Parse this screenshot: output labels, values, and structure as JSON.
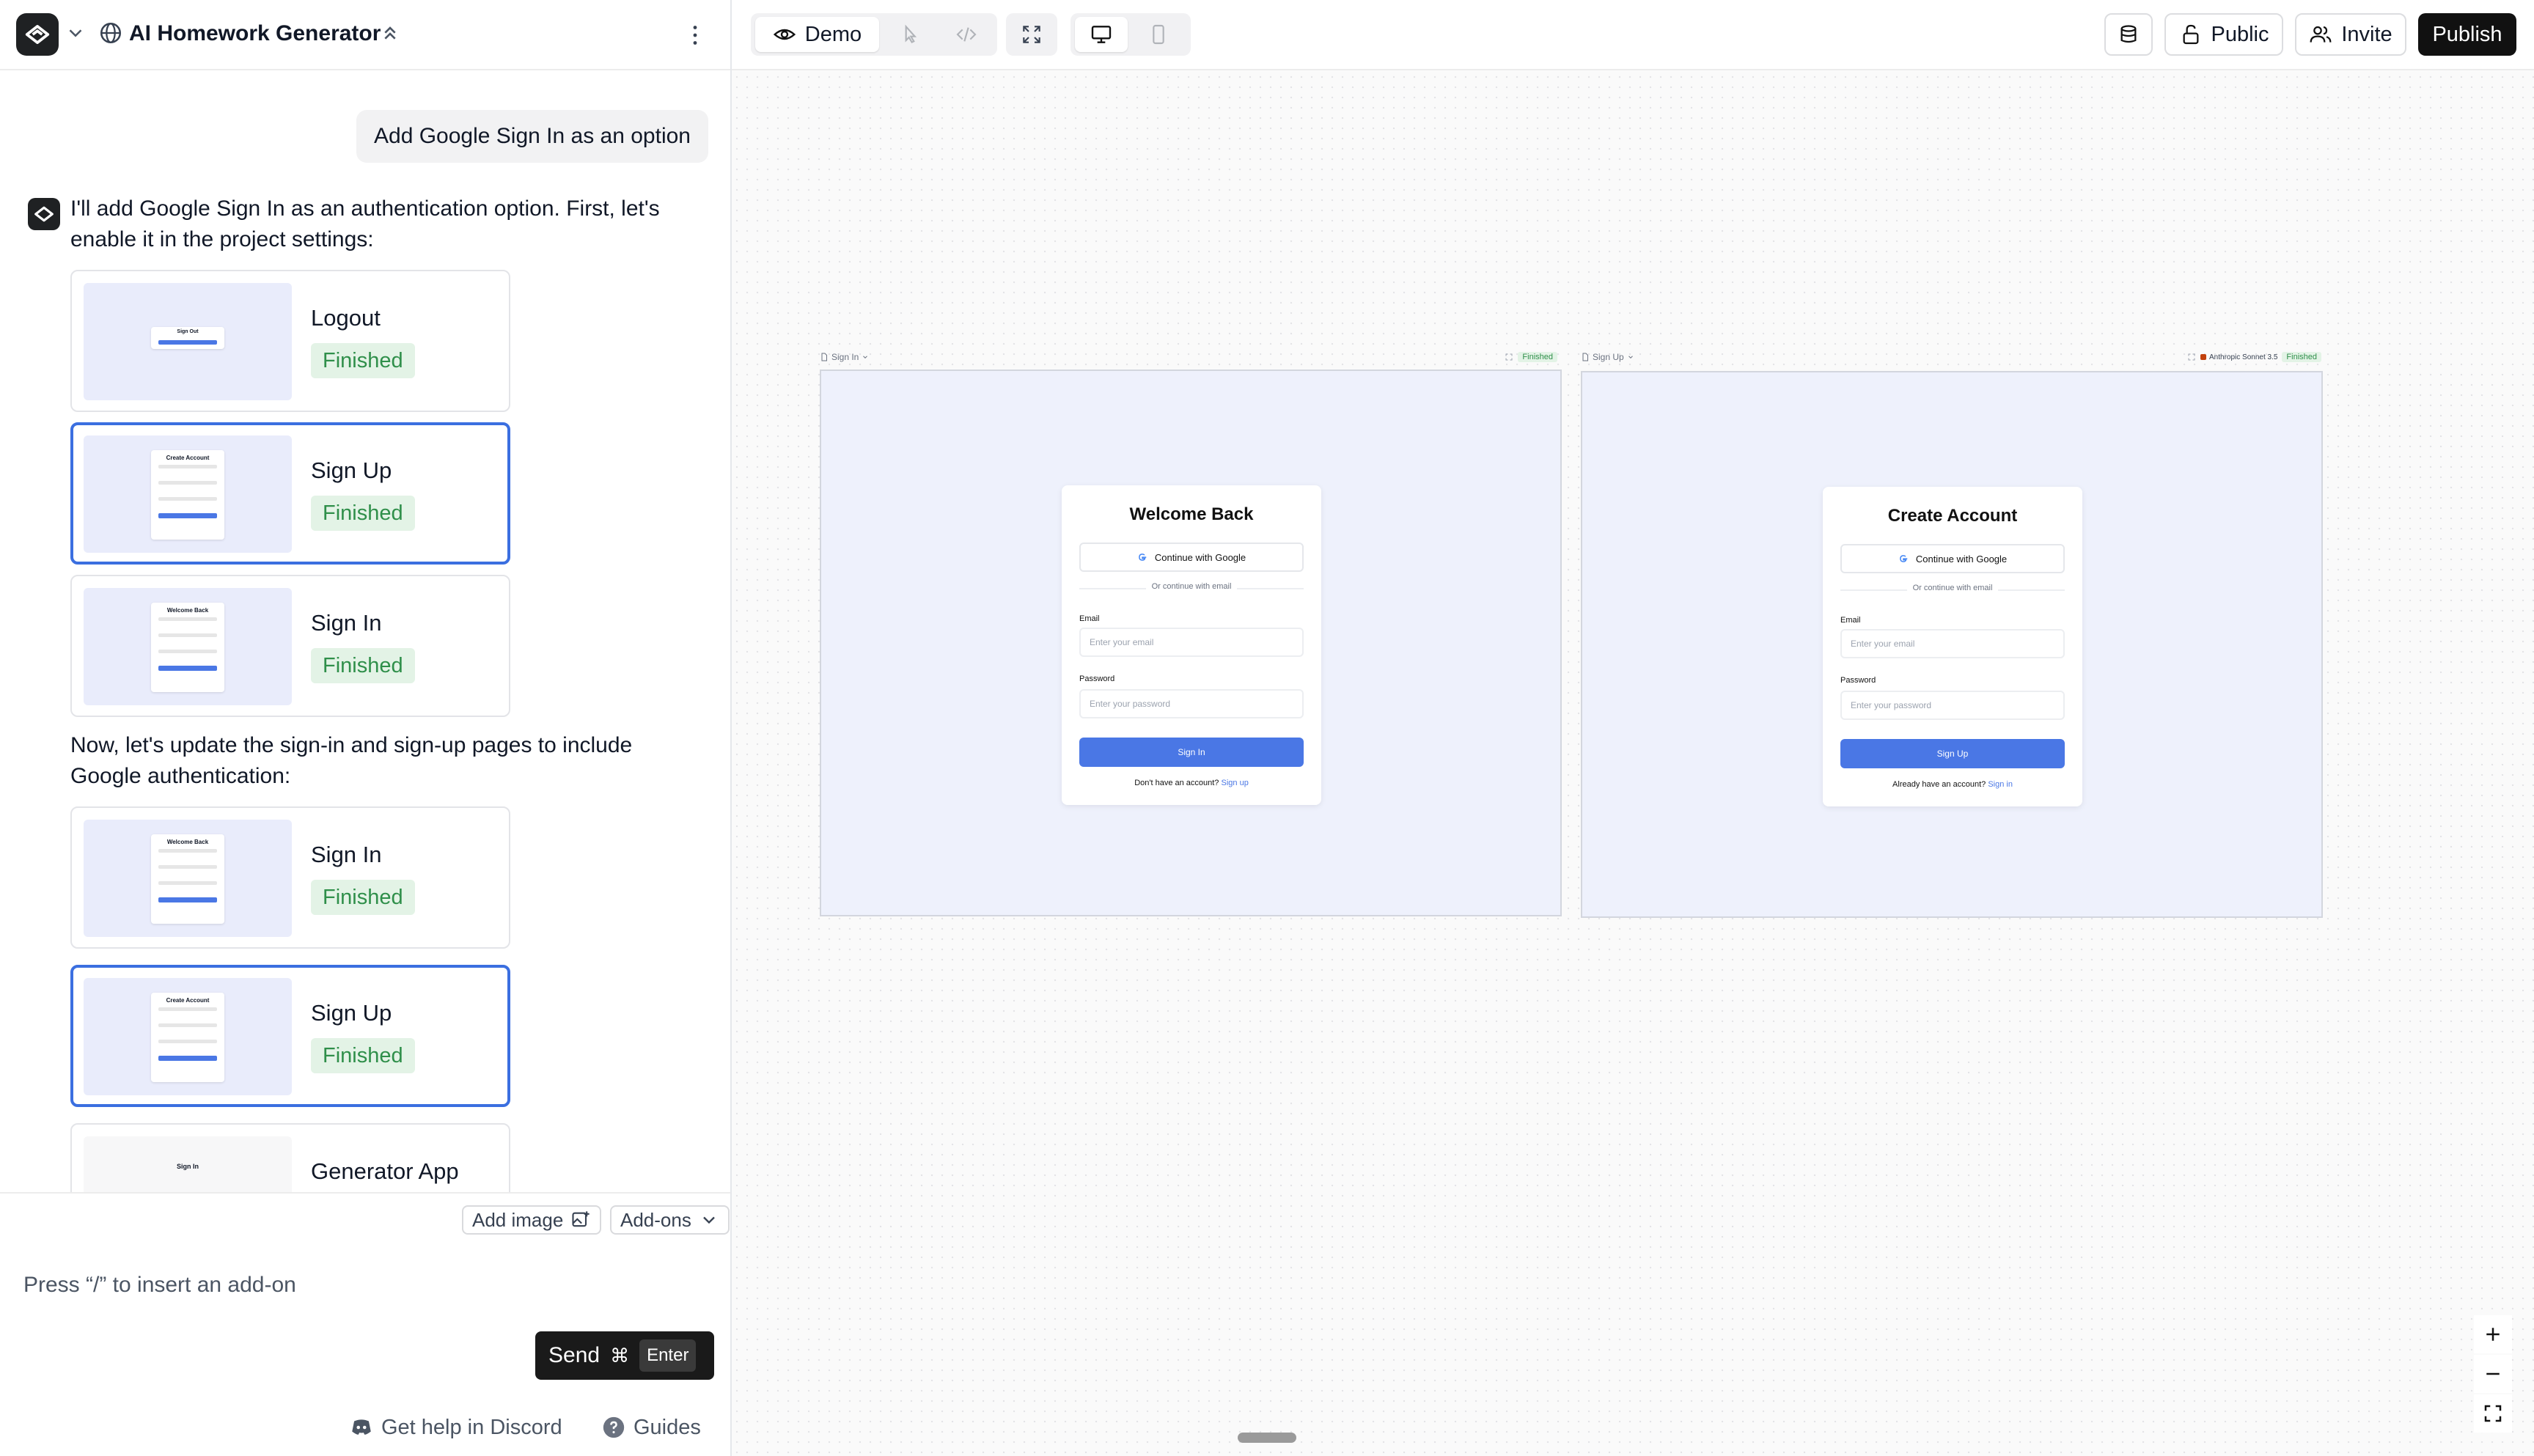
{
  "header": {
    "project_title": "AI Homework Generator"
  },
  "chat": {
    "user_message": "Add Google Sign In as an option",
    "ai_message_1": "I'll add Google Sign In as an authentication option. First, let's enable it in the project settings:",
    "ai_message_2": "Now, let's update the sign-in and sign-up pages to include Google authentication:",
    "cards": [
      {
        "title": "Logout",
        "status": "Finished",
        "thumb_title": "Sign Out"
      },
      {
        "title": "Sign Up",
        "status": "Finished",
        "thumb_title": "Create Account"
      },
      {
        "title": "Sign In",
        "status": "Finished",
        "thumb_title": "Welcome Back"
      },
      {
        "title": "Sign In",
        "status": "Finished",
        "thumb_title": "Welcome Back"
      },
      {
        "title": "Sign Up",
        "status": "Finished",
        "thumb_title": "Create Account"
      },
      {
        "title": "Generator App",
        "status": "",
        "thumb_title": "Sign In"
      }
    ]
  },
  "composer": {
    "add_image": "Add image",
    "addons": "Add-ons",
    "placeholder": "Press “/” to insert an add-on",
    "send": "Send",
    "cmd": "⌘",
    "enter": "Enter"
  },
  "footer": {
    "discord": "Get help in Discord",
    "guides": "Guides"
  },
  "toolbar": {
    "demo": "Demo",
    "public": "Public",
    "invite": "Invite",
    "publish": "Publish"
  },
  "canvas": {
    "signin": {
      "frame_name": "Sign In",
      "status": "Finished",
      "title": "Welcome Back",
      "google": "Continue with Google",
      "divider": "Or continue with email",
      "email_label": "Email",
      "email_ph": "Enter your email",
      "password_label": "Password",
      "password_ph": "Enter your password",
      "button": "Sign In",
      "footer_text": "Don't have an account?",
      "footer_link": "Sign up"
    },
    "signup": {
      "frame_name": "Sign Up",
      "model": "Anthropic Sonnet 3.5",
      "status": "Finished",
      "title": "Create Account",
      "google": "Continue with Google",
      "divider": "Or continue with email",
      "email_label": "Email",
      "email_ph": "Enter your email",
      "password_label": "Password",
      "password_ph": "Enter your password",
      "button": "Sign Up",
      "footer_text": "Already have an account?",
      "footer_link": "Sign in"
    }
  },
  "colors": {
    "accent": "#3b6fe0",
    "finished_bg": "#e3f3e6",
    "finished_text": "#2f8f4a",
    "dark": "#1f2123"
  }
}
